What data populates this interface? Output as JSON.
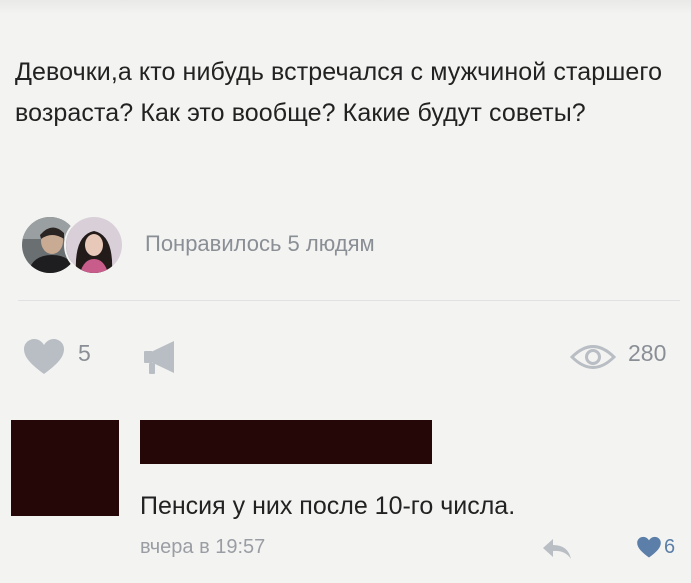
{
  "post": {
    "text": "Девочки,а кто нибудь встречался с мужчиной старшего возраста? Как это вообще? Какие будут советы?"
  },
  "likers": {
    "text": "Понравилось 5 людям",
    "avatars": [
      "avatar",
      "avatar"
    ]
  },
  "actions": {
    "like_icon": "heart-icon",
    "like_count": "5",
    "share_icon": "megaphone-icon",
    "views_icon": "eye-icon",
    "views_count": "280"
  },
  "comment": {
    "text": "Пенсия у них после 10-го числа.",
    "time": "вчера в 19:57",
    "reply_icon": "reply-arrow-icon",
    "like_icon": "heart-icon",
    "like_count": "6"
  },
  "colors": {
    "background": "#f3f3f1",
    "text": "#222222",
    "muted": "#8a8f96",
    "accent_blue": "#5b7fa8",
    "redaction": "#250707"
  }
}
